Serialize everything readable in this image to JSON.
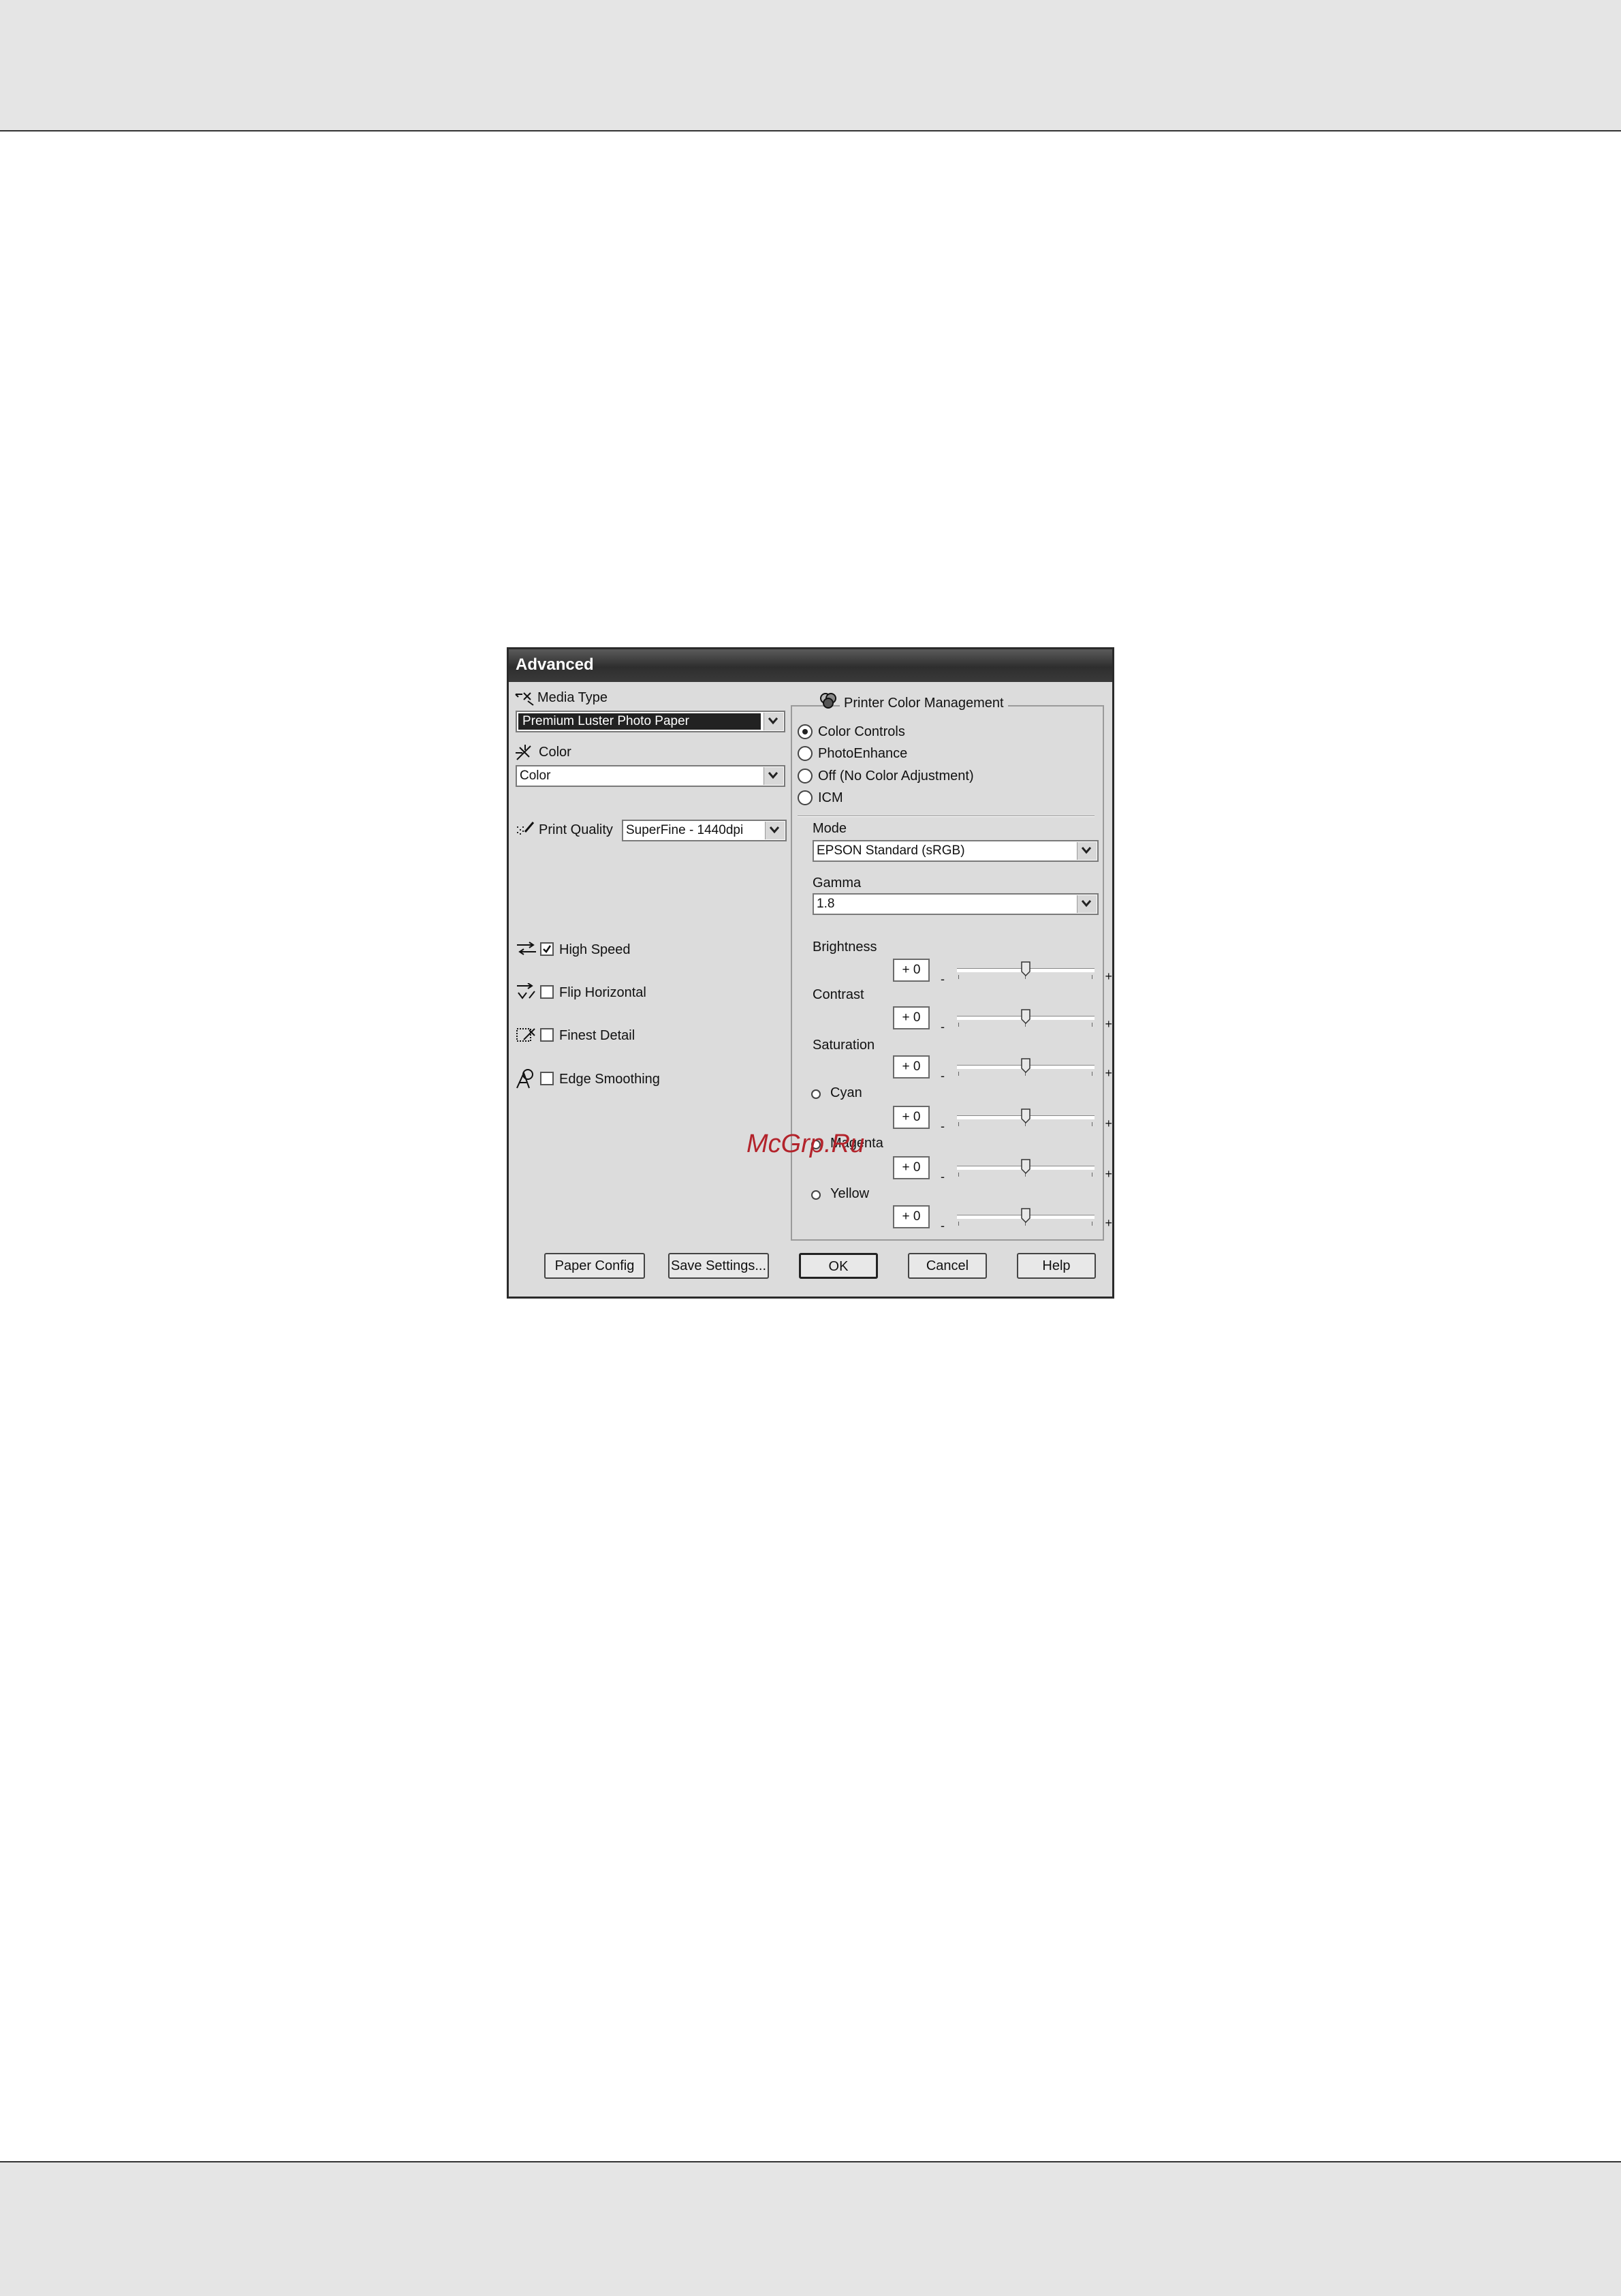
{
  "page": {
    "watermark": "McGrp.Ru"
  },
  "dialog": {
    "title": "Advanced",
    "media_type": {
      "label": "Media Type",
      "value": "Premium Luster Photo Paper"
    },
    "color": {
      "label": "Color",
      "value": "Color"
    },
    "print_quality": {
      "label": "Print Quality",
      "value": "SuperFine - 1440dpi"
    },
    "options": [
      {
        "label": "High Speed",
        "checked": true
      },
      {
        "label": "Flip Horizontal",
        "checked": false
      },
      {
        "label": "Finest Detail",
        "checked": false
      },
      {
        "label": "Edge Smoothing",
        "checked": false
      }
    ],
    "color_management": {
      "title": "Printer Color Management",
      "modes": [
        {
          "label": "Color Controls",
          "selected": true
        },
        {
          "label": "PhotoEnhance",
          "selected": false
        },
        {
          "label": "Off (No Color Adjustment)",
          "selected": false
        },
        {
          "label": "ICM",
          "selected": false
        }
      ],
      "mode": {
        "label": "Mode",
        "value": "EPSON Standard (sRGB)"
      },
      "gamma": {
        "label": "Gamma",
        "value": "1.8"
      },
      "adjustments": [
        {
          "label": "Brightness",
          "value": "+ 0",
          "level": 0.5
        },
        {
          "label": "Contrast",
          "value": "+ 0",
          "level": 0.5
        },
        {
          "label": "Saturation",
          "value": "+ 0",
          "level": 0.5
        },
        {
          "label": "Cyan",
          "value": "+ 0",
          "level": 0.5
        },
        {
          "label": "Magenta",
          "value": "+ 0",
          "level": 0.5
        },
        {
          "label": "Yellow",
          "value": "+ 0",
          "level": 0.5
        }
      ],
      "slider_minus": "-",
      "slider_plus": "+"
    },
    "buttons": {
      "paper_config": "Paper Config",
      "save_settings": "Save Settings...",
      "ok": "OK",
      "cancel": "Cancel",
      "help": "Help"
    }
  }
}
